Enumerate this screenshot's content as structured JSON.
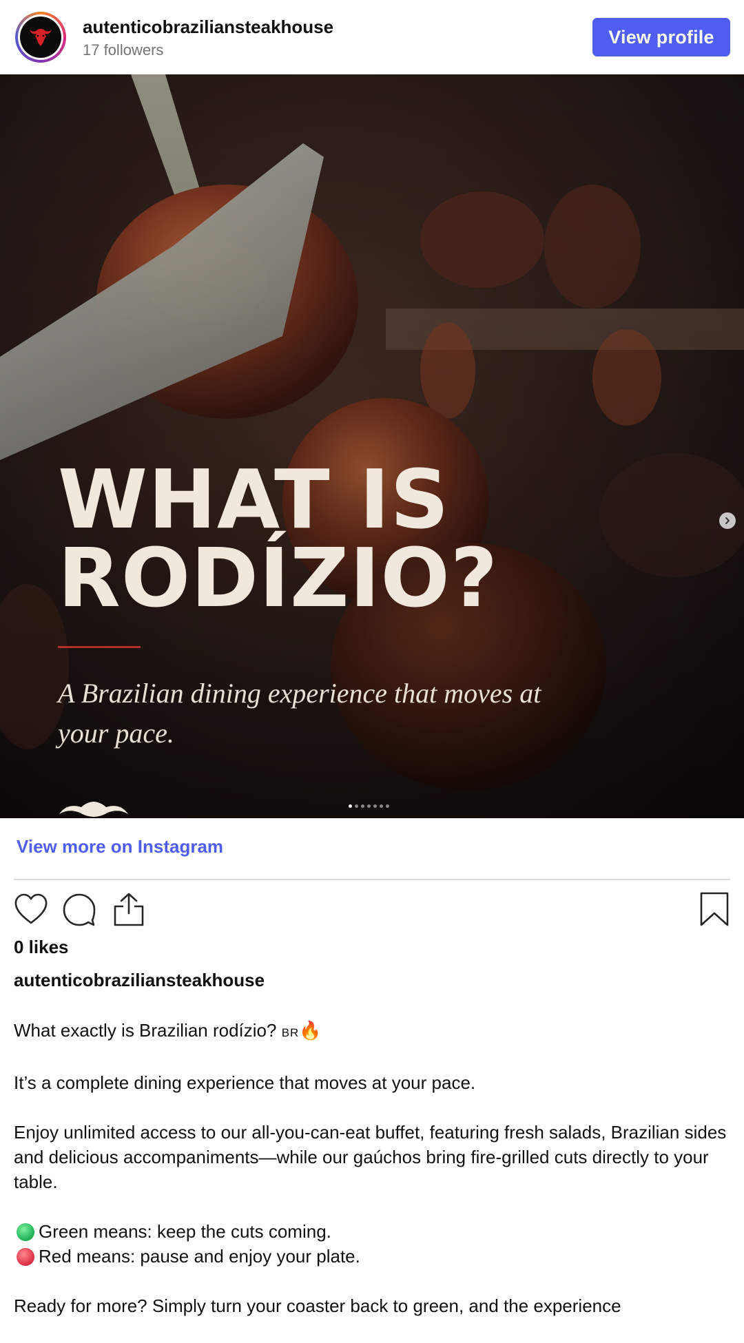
{
  "header": {
    "username": "autenticobraziliansteakhouse",
    "followers": "17 followers",
    "view_profile_label": "View profile"
  },
  "slide": {
    "title_line1": "WHAT IS",
    "title_line2": "RODÍZIO?",
    "subtitle": "A Brazilian dining experience that moves at your pace.",
    "total_slides": 7,
    "current_slide": 1
  },
  "post": {
    "view_more_label": "View more on Instagram",
    "likes": "0 likes",
    "caption_user": "autenticobraziliansteakhouse",
    "caption": {
      "line1_text": "What exactly is Brazilian rodízio?",
      "line1_flag": "BR",
      "line1_emoji": "🔥",
      "para2": "It’s a complete dining experience that moves at your pace.",
      "para3": "Enjoy unlimited access to our all-you-can-eat buffet, featuring fresh salads, Brazilian sides and delicious accompaniments—while our gaúchos bring fire-grilled cuts directly to your table.",
      "green_line": "Green means: keep the cuts coming.",
      "red_line": "Red means: pause and enjoy your plate.",
      "para5": "Ready for more? Simply turn your coaster back to green, and the experience"
    }
  },
  "colors": {
    "accent": "#4f5ef0",
    "divider": "#dbdbdb",
    "secondary_text": "#737373"
  },
  "icons": [
    "heart-icon",
    "comment-icon",
    "share-icon",
    "bookmark-icon",
    "chevron-right-icon",
    "bull-logo-icon"
  ]
}
